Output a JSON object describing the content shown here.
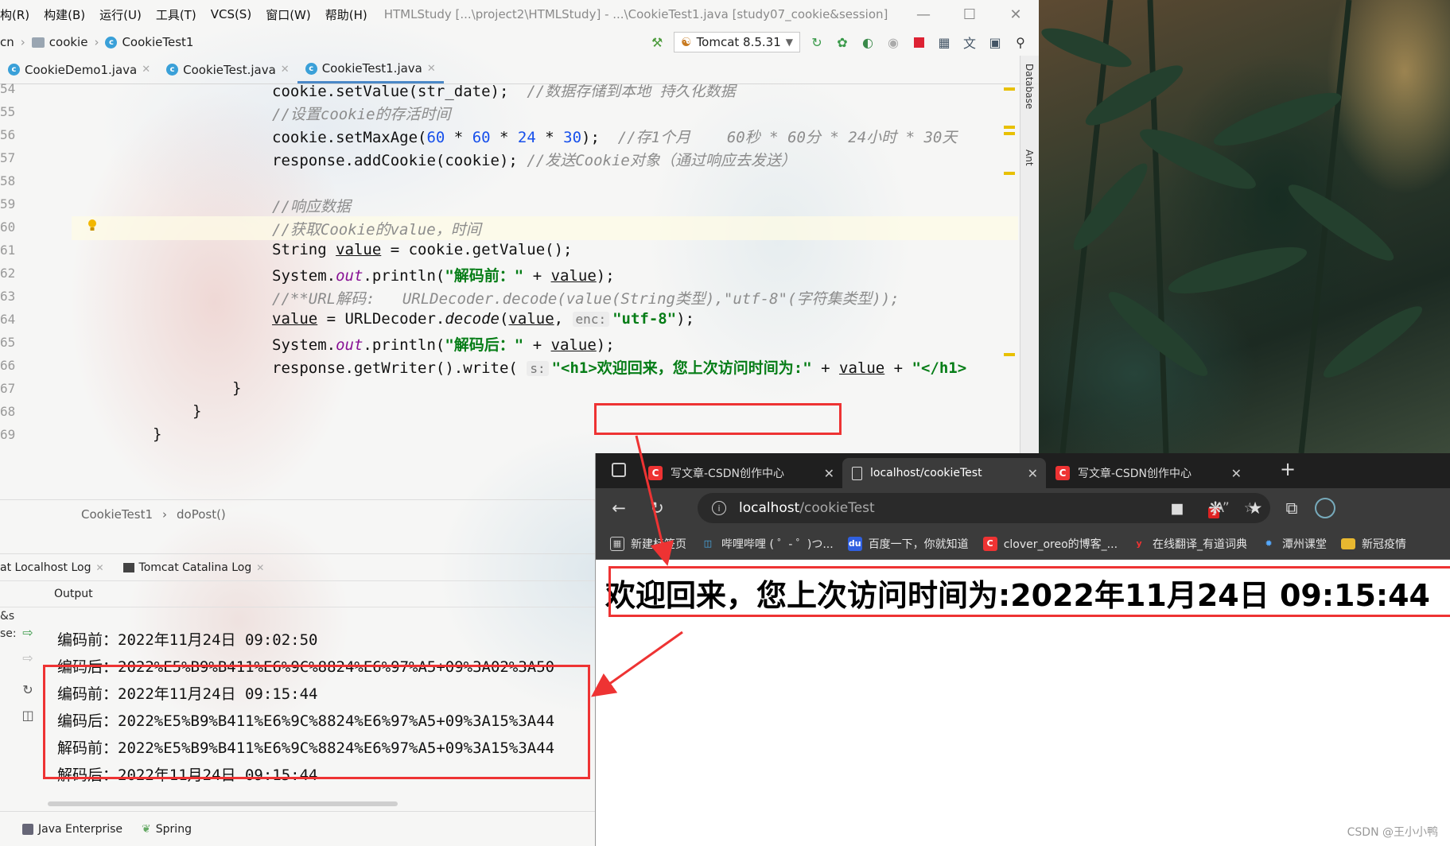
{
  "ide": {
    "menu": [
      "构(R)",
      "构建(B)",
      "运行(U)",
      "工具(T)",
      "VCS(S)",
      "窗口(W)",
      "帮助(H)"
    ],
    "title": "HTMLStudy [...\\project2\\HTMLStudy] - ...\\CookieTest1.java [study07_cookie&session]",
    "breadcrumb": [
      "cn",
      "cookie",
      "CookieTest1"
    ],
    "run_config": "Tomcat 8.5.31",
    "tabs": [
      {
        "label": "CookieDemo1.java"
      },
      {
        "label": "CookieTest.java"
      },
      {
        "label": "CookieTest1.java"
      }
    ],
    "right_strip": [
      "Database",
      "Ant"
    ],
    "line_numbers": [
      "54",
      "55",
      "56",
      "57",
      "58",
      "59",
      "60",
      "61",
      "62",
      "63",
      "64",
      "65",
      "66",
      "67",
      "68",
      "69"
    ],
    "code": {
      "l0_code": "cookie.setValue(str_date);",
      "l0_comment": "//数据存储到本地 持久化数据",
      "l1_comment": "//设置cookie的存活时间",
      "l2_pre": "cookie.setMaxAge(",
      "l2_n1": "60",
      "l2_op1": " * ",
      "l2_n2": "60",
      "l2_op2": " * ",
      "l2_n3": "24",
      "l2_op3": " * ",
      "l2_n4": "30",
      "l2_post": ");",
      "l2_comment": "//存1个月    60秒 * 60分 * 24小时 * 30天",
      "l3_code": "response.addCookie(cookie);",
      "l3_comment": "//发送Cookie对象（通过响应去发送）",
      "l5_comment": "//响应数据",
      "l6_comment": "//获取Cookie的value，时间",
      "l7_a": "String ",
      "l7_b": "value",
      "l7_c": " = cookie.getValue();",
      "l8_a": "System.",
      "l8_b": "out",
      "l8_c": ".println(",
      "l8_d": "\"解码前：\"",
      "l8_e": " + ",
      "l8_f": "value",
      "l8_g": ");",
      "l9_comment": "//**URL解码:   URLDecoder.decode(value(String类型),\"utf-8\"(字符集类型));",
      "l10_a": "value",
      "l10_b": " = URLDecoder.",
      "l10_c": "decode",
      "l10_d": "(",
      "l10_e": "value",
      "l10_f": ", ",
      "l10_hint": "enc:",
      "l10_g": "\"utf-8\"",
      "l10_h": ");",
      "l11_a": "System.",
      "l11_b": "out",
      "l11_c": ".println(",
      "l11_d": "\"解码后：\"",
      "l11_e": " + ",
      "l11_f": "value",
      "l11_g": ");",
      "l12_a": "response.getWriter().write(",
      "l12_hint": "s:",
      "l12_b": "\"<h1>欢迎回来，您上次访问时间为",
      "l12_c": ":\"",
      "l12_d": " + ",
      "l12_e": "value",
      "l12_f": " + ",
      "l12_g": "\"</h1>",
      "l13": "}",
      "l14": "}",
      "l15": "}"
    },
    "method_breadcrumb": [
      "CookieTest1",
      "doPost()"
    ],
    "tool_tabs": [
      "at Localhost Log",
      "Tomcat Catalina Log"
    ],
    "output_label": "Output",
    "side_clip": [
      "&s",
      "se:"
    ],
    "output_lines": [
      "编码前：2022年11月24日 09:02:50",
      "编码后：2022%E5%B9%B411%E6%9C%8824%E6%97%A5+09%3A02%3A50",
      "编码前：2022年11月24日 09:15:44",
      "编码后：2022%E5%B9%B411%E6%9C%8824%E6%97%A5+09%3A15%3A44",
      "解码前：2022%E5%B9%B411%E6%9C%8824%E6%97%A5+09%3A15%3A44",
      "解码后：2022年11月24日 09:15:44"
    ],
    "bottom_tabs": [
      "Java Enterprise",
      "Spring"
    ]
  },
  "browser": {
    "tabs": [
      {
        "label": "写文章-CSDN创作中心",
        "icon": "csdn-icon"
      },
      {
        "label": "localhost/cookieTest",
        "icon": "page-icon"
      },
      {
        "label": "写文章-CSDN创作中心",
        "icon": "csdn-icon"
      }
    ],
    "address": {
      "host": "localhost",
      "path": "/cookieTest"
    },
    "badge": "1",
    "bookmarks": [
      {
        "label": "新建标签页"
      },
      {
        "label": "哔哩哔哩 ( ゜- ゜)つ..."
      },
      {
        "label": "百度一下，你就知道"
      },
      {
        "label": "clover_oreo的博客_..."
      },
      {
        "label": "在线翻译_有道词典"
      },
      {
        "label": "潭州课堂"
      },
      {
        "label": "新冠疫情"
      }
    ],
    "page_heading": "欢迎回来，您上次访问时间为:2022年11月24日 09:15:44"
  },
  "watermark": "CSDN @王小小鸭",
  "colors": {
    "highlight_box": "#ee3333",
    "string": "#067d17",
    "number": "#1750eb",
    "comment": "#8c8c8c",
    "field": "#871094"
  }
}
